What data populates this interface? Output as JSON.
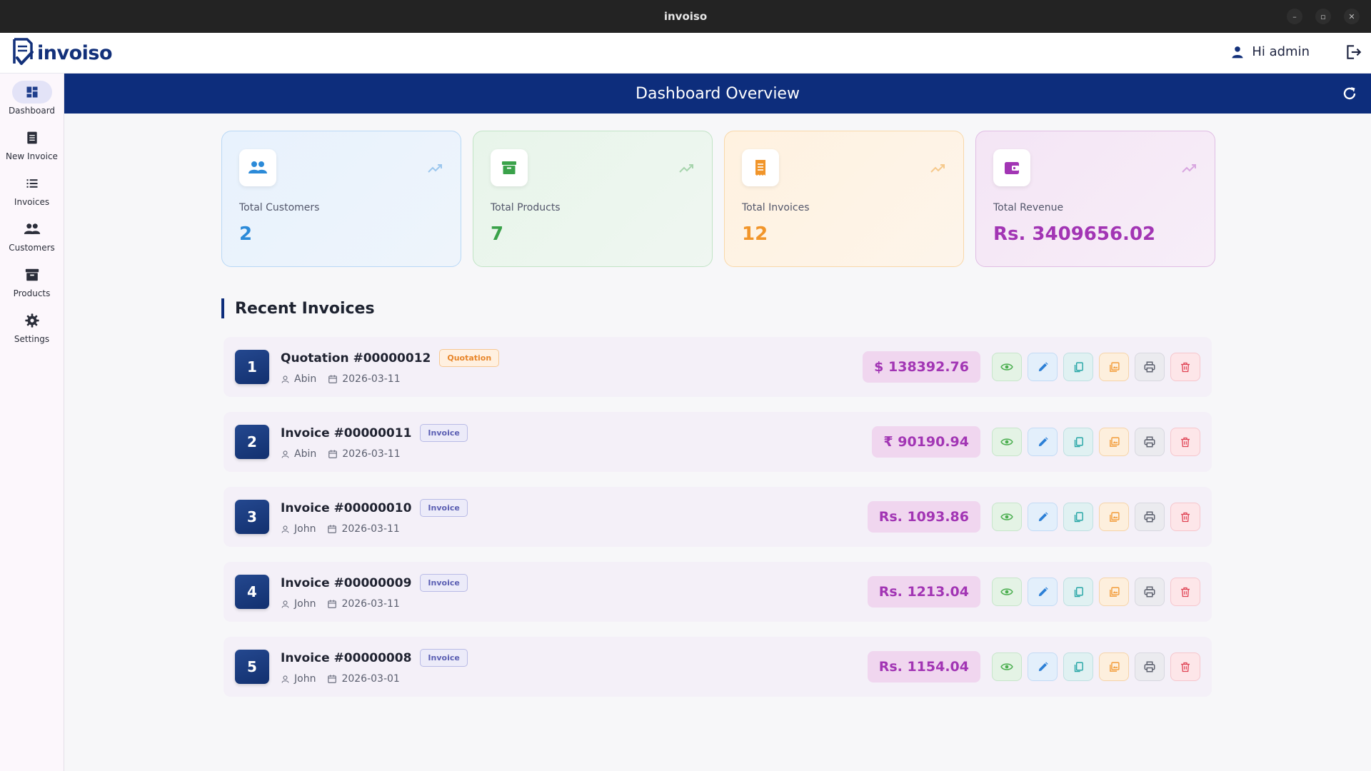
{
  "window": {
    "title": "invoiso"
  },
  "header": {
    "brand": "invoiso",
    "greeting": "Hi admin"
  },
  "sidebar": {
    "items": [
      {
        "label": "Dashboard",
        "icon": "dashboard-icon",
        "active": true
      },
      {
        "label": "New Invoice",
        "icon": "note-add-icon",
        "active": false
      },
      {
        "label": "Invoices",
        "icon": "list-icon",
        "active": false
      },
      {
        "label": "Customers",
        "icon": "people-icon",
        "active": false
      },
      {
        "label": "Products",
        "icon": "archive-box-icon",
        "active": false
      },
      {
        "label": "Settings",
        "icon": "gear-icon",
        "active": false
      }
    ]
  },
  "banner": {
    "title": "Dashboard Overview"
  },
  "stats": [
    {
      "label": "Total Customers",
      "value": "2",
      "color": "#2b8ad8"
    },
    {
      "label": "Total Products",
      "value": "7",
      "color": "#3aa24a"
    },
    {
      "label": "Total Invoices",
      "value": "12",
      "color": "#f1952a"
    },
    {
      "label": "Total Revenue",
      "value": "Rs. 3409656.02",
      "color": "#a235b4"
    }
  ],
  "recent": {
    "title": "Recent Invoices",
    "rows": [
      {
        "index": "1",
        "title": "Quotation #00000012",
        "type": "Quotation",
        "customer": "Abin",
        "date": "2026-03-11",
        "amount": "$ 138392.76"
      },
      {
        "index": "2",
        "title": "Invoice #00000011",
        "type": "Invoice",
        "customer": "Abin",
        "date": "2026-03-11",
        "amount": "₹ 90190.94"
      },
      {
        "index": "3",
        "title": "Invoice #00000010",
        "type": "Invoice",
        "customer": "John",
        "date": "2026-03-11",
        "amount": "Rs. 1093.86"
      },
      {
        "index": "4",
        "title": "Invoice #00000009",
        "type": "Invoice",
        "customer": "John",
        "date": "2026-03-11",
        "amount": "Rs. 1213.04"
      },
      {
        "index": "5",
        "title": "Invoice #00000008",
        "type": "Invoice",
        "customer": "John",
        "date": "2026-03-01",
        "amount": "Rs. 1154.04"
      }
    ]
  },
  "colors": {
    "primary": "#0d2d7c",
    "accent_revenue": "#a235b4",
    "view": "#4caf50",
    "edit": "#2b7fd6",
    "duplicate": "#26a6a6",
    "image": "#f39c3a",
    "print": "#5f6370",
    "delete": "#e04455"
  }
}
